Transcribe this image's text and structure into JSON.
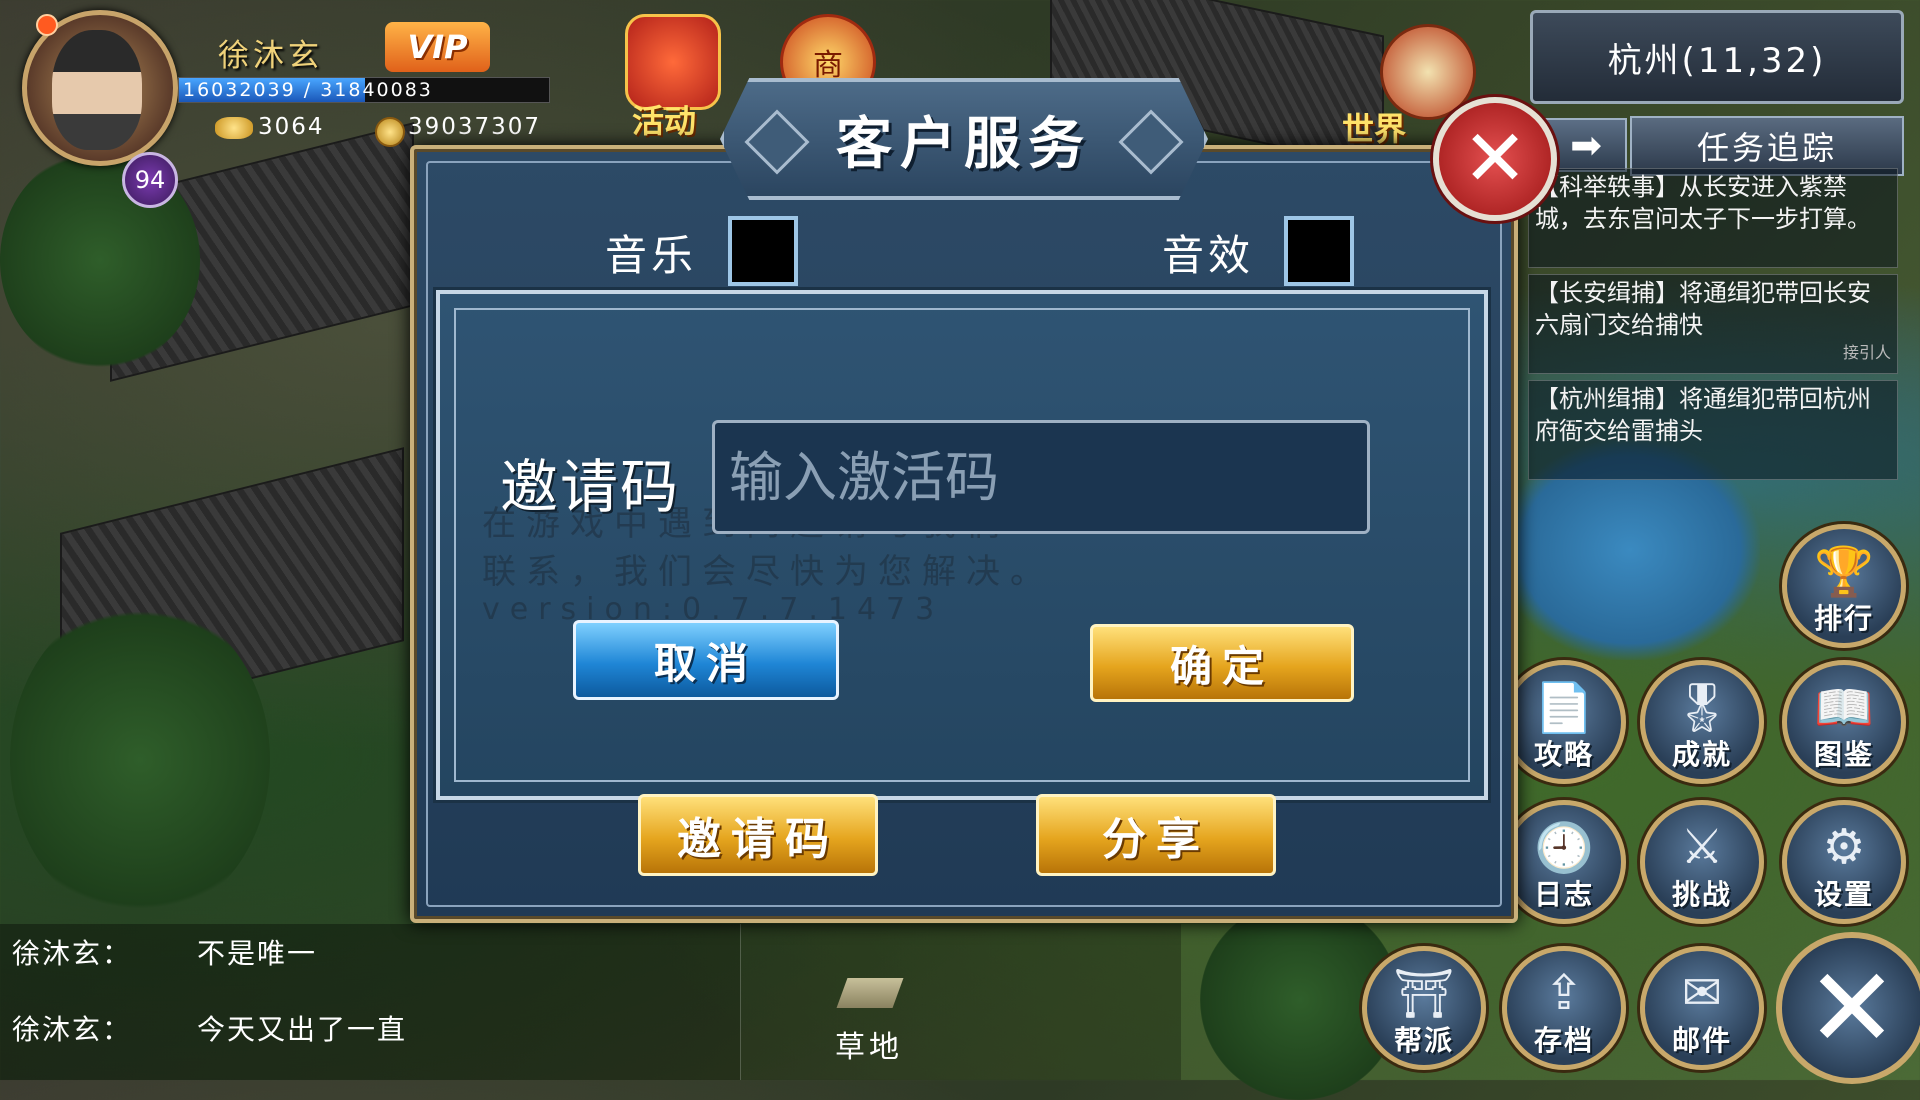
{
  "player": {
    "name": "徐沐玄",
    "vip": "VIP",
    "exp_text": "16032039 / 31840083",
    "exp_fraction": 0.503,
    "level": "94",
    "gold": "3064",
    "coins": "39037307"
  },
  "top_icons": {
    "activity_label": "活动",
    "shop_glyph": "商",
    "world_label": "世界"
  },
  "location": "杭州(11,32)",
  "quest_tracker": {
    "title": "任务追踪",
    "arrow": "➡",
    "items": [
      {
        "text": "【科举轶事】从长安进入紫禁城，去东宫问太子下一步打算。"
      },
      {
        "text": "【长安缉捕】将通缉犯带回长安六扇门交给捕快",
        "hint": "接引人"
      },
      {
        "text": "【杭州缉捕】将通缉犯带回杭州府衙交给雷捕头"
      }
    ]
  },
  "dialog": {
    "title": "客户服务",
    "close_glyph": "✕",
    "music_label": "音乐",
    "sfx_label": "音效",
    "background_text": [
      "在游戏中遇到问题请与我们",
      "联系，我们会尽快为您解决。",
      "version:0.7.7.1473"
    ],
    "invite_label": "邀请码",
    "invite_placeholder": "输入激活码",
    "invite_value": "",
    "cancel": "取消",
    "confirm": "确定",
    "invite_tab": "邀请码",
    "share": "分享"
  },
  "right_menu": [
    {
      "label": "排行",
      "icon": "trophy-icon",
      "glyph": "🏆"
    },
    {
      "label": "攻略",
      "icon": "document-icon",
      "glyph": "📄"
    },
    {
      "label": "成就",
      "icon": "medal-icon",
      "glyph": "🎖"
    },
    {
      "label": "图鉴",
      "icon": "book-icon",
      "glyph": "📖"
    },
    {
      "label": "日志",
      "icon": "clock-icon",
      "glyph": "🕘"
    },
    {
      "label": "挑战",
      "icon": "fight-icon",
      "glyph": "⚔"
    },
    {
      "label": "设置",
      "icon": "gear-icon",
      "glyph": "⚙"
    },
    {
      "label": "帮派",
      "icon": "guild-icon",
      "glyph": "⛩"
    },
    {
      "label": "存档",
      "icon": "upload-icon",
      "glyph": "⇪"
    },
    {
      "label": "邮件",
      "icon": "mail-icon",
      "glyph": "✉"
    }
  ],
  "close_menu_glyph": "✕",
  "chat": [
    {
      "name": "徐沐玄：",
      "message": "不是唯一"
    },
    {
      "name": "徐沐玄：",
      "message": "今天又出了一直"
    }
  ],
  "terrain": "草地"
}
